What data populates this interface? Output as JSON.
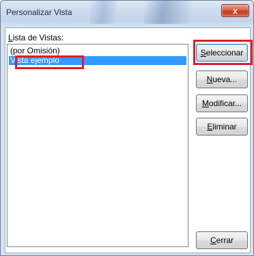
{
  "window": {
    "title": "Personalizar Vista",
    "close_label": "x"
  },
  "list": {
    "label_accesskey": "L",
    "label_rest": "ista de Vistas:",
    "items": [
      {
        "label": "(por Omisión)",
        "selected": false
      },
      {
        "label": "Vista ejemplo",
        "selected": true
      }
    ]
  },
  "buttons": {
    "select": {
      "accesskey": "S",
      "rest": "eleccionar"
    },
    "new": {
      "accesskey": "N",
      "rest": "ueva..."
    },
    "modify": {
      "accesskey": "M",
      "rest": "odificar..."
    },
    "delete": {
      "accesskey": "E",
      "rest": "liminar"
    },
    "close": {
      "accesskey": "C",
      "rest": "errar"
    }
  },
  "colors": {
    "selection": "#3399ff",
    "highlight_annotation": "#e21b2a"
  }
}
